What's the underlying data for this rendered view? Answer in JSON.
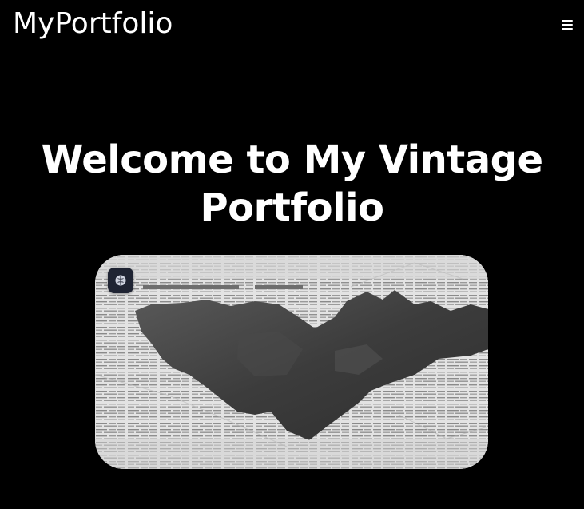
{
  "header": {
    "logo_text": "MyPortfolio",
    "menu_icon": "hamburger-menu-icon"
  },
  "hero": {
    "title": "Welcome to My Vintage Portfolio",
    "image_subject": "torn-newspaper-image",
    "badge_icon": "brain-icon"
  },
  "colors": {
    "background": "#000000",
    "text": "#ffffff",
    "divider": "#d9d9d9",
    "badge": "#1f2433"
  }
}
